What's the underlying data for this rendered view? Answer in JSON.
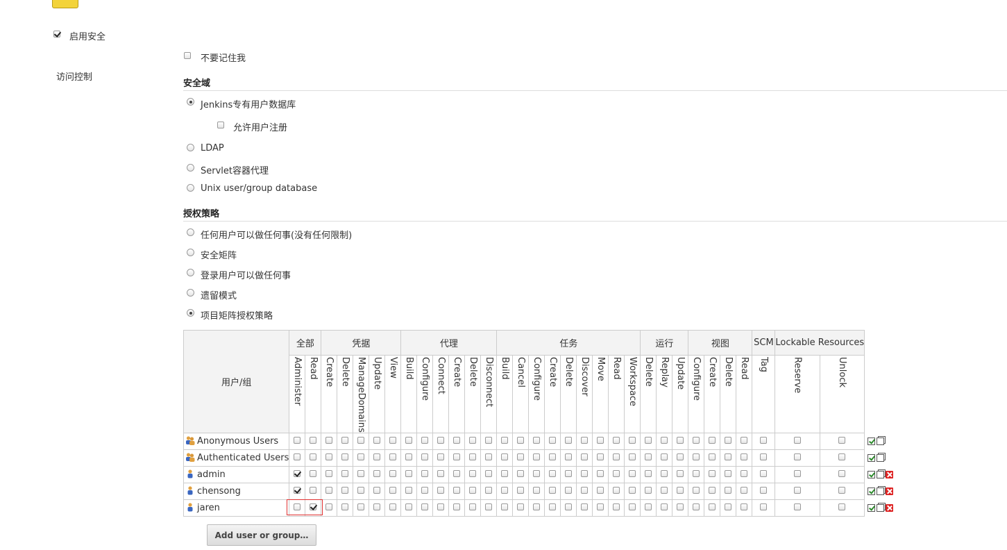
{
  "page": {
    "enable_security_label": "启用安全",
    "enable_security_checked": true,
    "no_remember_me_label": "不要记住我",
    "no_remember_me_checked": false,
    "access_control_label": "访问控制"
  },
  "security_realm": {
    "heading": "安全域",
    "options": [
      {
        "label": "Jenkins专有用户数据库",
        "selected": true
      },
      {
        "label": "LDAP",
        "selected": false
      },
      {
        "label": "Servlet容器代理",
        "selected": false
      },
      {
        "label": "Unix user/group database",
        "selected": false
      }
    ],
    "allow_signup_label": "允许用户注册",
    "allow_signup_checked": false
  },
  "authorization": {
    "heading": "授权策略",
    "options": [
      {
        "label": "任何用户可以做任何事(没有任何限制)",
        "selected": false
      },
      {
        "label": "安全矩阵",
        "selected": false
      },
      {
        "label": "登录用户可以做任何事",
        "selected": false
      },
      {
        "label": "遗留模式",
        "selected": false
      },
      {
        "label": "项目矩阵授权策略",
        "selected": true
      }
    ]
  },
  "matrix": {
    "user_group_header": "用户/组",
    "groups": [
      {
        "name": "全部",
        "permissions": [
          "Administer",
          "Read"
        ]
      },
      {
        "name": "凭据",
        "permissions": [
          "Create",
          "Delete",
          "ManageDomains",
          "Update",
          "View"
        ]
      },
      {
        "name": "代理",
        "permissions": [
          "Build",
          "Configure",
          "Connect",
          "Create",
          "Delete",
          "Disconnect"
        ]
      },
      {
        "name": "任务",
        "permissions": [
          "Build",
          "Cancel",
          "Configure",
          "Create",
          "Delete",
          "Discover",
          "Move",
          "Read",
          "Workspace"
        ]
      },
      {
        "name": "运行",
        "permissions": [
          "Delete",
          "Replay",
          "Update"
        ]
      },
      {
        "name": "视图",
        "permissions": [
          "Configure",
          "Create",
          "Delete",
          "Read"
        ]
      },
      {
        "name": "SCM",
        "permissions": [
          "Tag"
        ]
      },
      {
        "name": "Lockable Resources",
        "permissions": [
          "Reserve",
          "Unlock"
        ]
      }
    ],
    "rows": [
      {
        "name": "Anonymous Users",
        "type": "group",
        "checked": [],
        "deletable": false
      },
      {
        "name": "Authenticated Users",
        "type": "group",
        "checked": [],
        "deletable": false
      },
      {
        "name": "admin",
        "type": "user",
        "checked": [
          0
        ],
        "deletable": true
      },
      {
        "name": "chensong",
        "type": "user",
        "checked": [
          0
        ],
        "deletable": true
      },
      {
        "name": "jaren",
        "type": "user",
        "checked": [
          1
        ],
        "deletable": true
      }
    ]
  },
  "add_button_label": "Add user or group…"
}
